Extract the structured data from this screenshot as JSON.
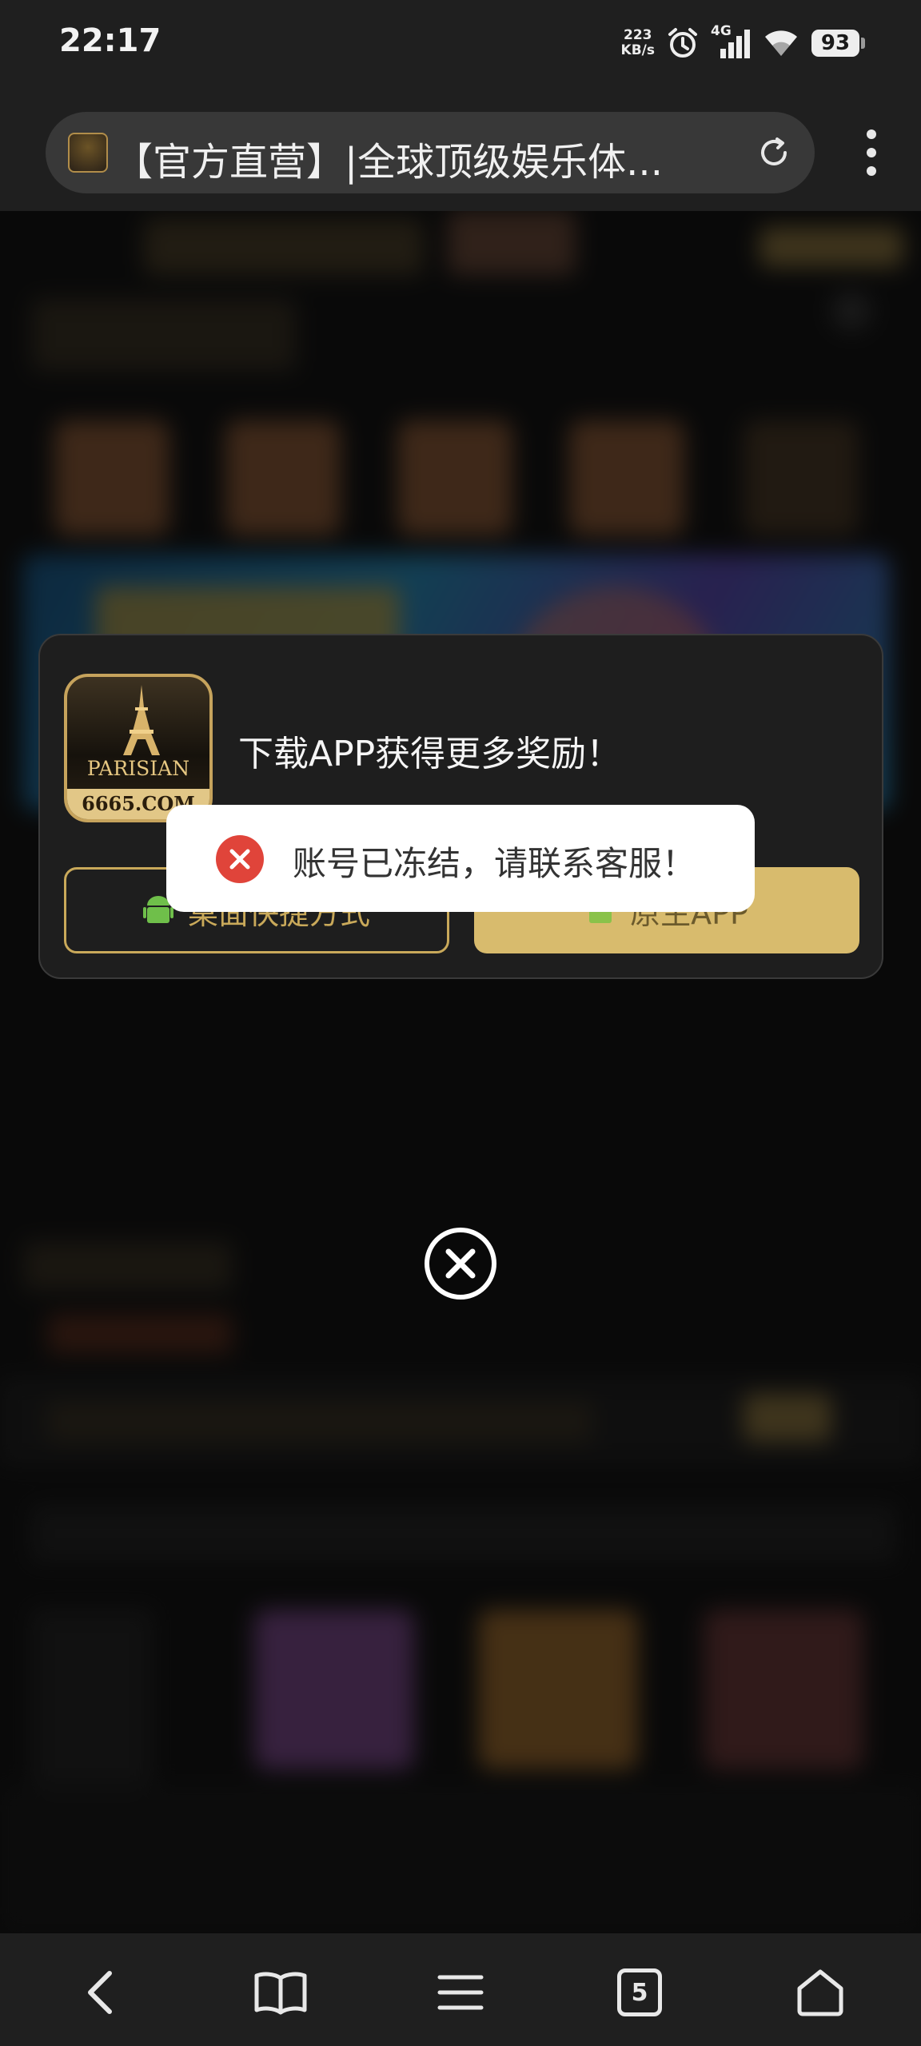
{
  "status_bar": {
    "time": "22:17",
    "net_speed_value": "223",
    "net_speed_unit": "KB/s",
    "network": "4G",
    "battery": "93",
    "icons": [
      "alarm-icon",
      "signal-icon",
      "wifi-icon",
      "battery-icon"
    ]
  },
  "browser": {
    "page_title": "【官方直营】|全球顶级娱乐体...",
    "tab_count": "5",
    "icons": [
      "reload-icon",
      "more-menu-icon"
    ]
  },
  "modal": {
    "logo_brand": "PARISIAN",
    "logo_domain": "6665.COM",
    "title": "下载APP获得更多奖励！",
    "shortcut_button": "桌面快捷方式",
    "native_button": "原生APP"
  },
  "toast": {
    "message": "账号已冻结，请联系客服！"
  },
  "nav": {
    "items": [
      "back-icon",
      "bookmarks-icon",
      "menu-icon",
      "tabs-icon",
      "home-icon"
    ]
  },
  "colors": {
    "accent_gold": "#d8bb6d",
    "error_red": "#e0443a",
    "panel": "#1e1e1e"
  }
}
